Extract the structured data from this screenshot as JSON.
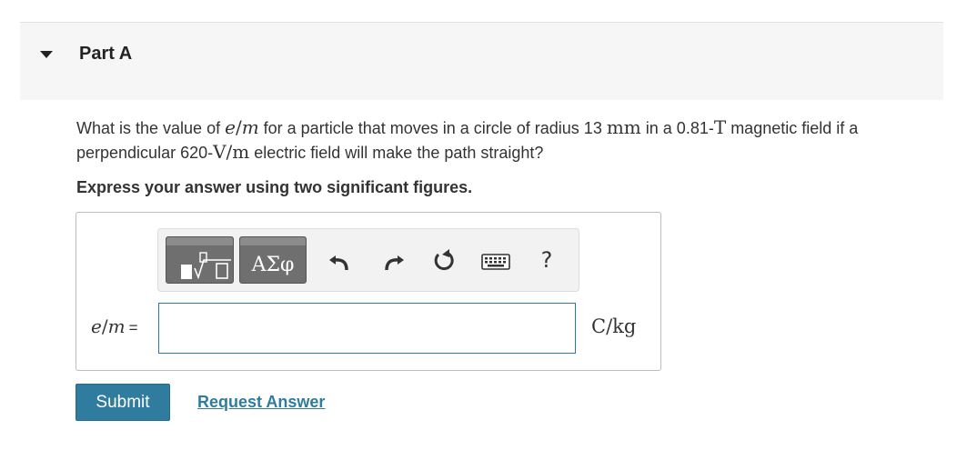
{
  "part": {
    "title": "Part A"
  },
  "question": {
    "text_1": "What is the value of ",
    "em_e": "e",
    "em_slash": "/",
    "em_m": "m",
    "text_2": " for a particle that moves in a circle of radius 13 ",
    "unit_mm": "mm",
    "text_3": " in a 0.81-",
    "unit_T": "T",
    "text_4": " magnetic field if a perpendicular 620-",
    "unit_Vm": "V/m",
    "text_5": " electric field will make the path straight?"
  },
  "instruction": "Express your answer using two significant figures.",
  "toolbar": {
    "greek_label": "ΑΣφ",
    "help_label": "?"
  },
  "answer": {
    "var_e": "e",
    "var_slash": "/",
    "var_m": "m",
    "equals": "=",
    "value": "",
    "placeholder": "",
    "unit": "C/kg"
  },
  "actions": {
    "submit_label": "Submit",
    "request_label": "Request Answer"
  },
  "colors": {
    "accent": "#2f7c9e",
    "header_bg": "#f6f6f6",
    "toolbar_button": "#6f6f6f"
  }
}
